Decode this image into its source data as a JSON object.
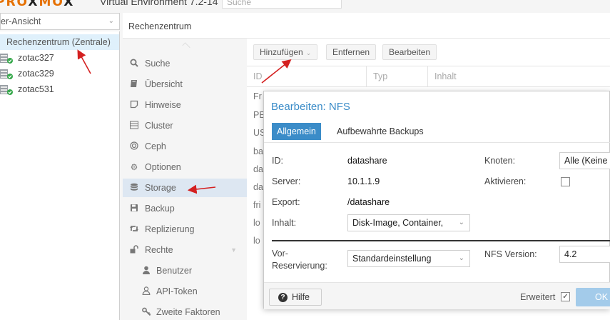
{
  "header": {
    "logo_part1": "PRO",
    "logo_x1": "X",
    "logo_part2": "MO",
    "logo_x2": "X",
    "version": "Virtual Environment 7.2-14",
    "search_placeholder": "Suche"
  },
  "tree": {
    "view_selector": "er-Ansicht",
    "root": "Rechenzentrum (Zentrale)",
    "nodes": [
      "zotac327",
      "zotac329",
      "zotac531"
    ]
  },
  "panel": {
    "title": "Rechenzentrum"
  },
  "nav": {
    "items": [
      {
        "label": "Suche",
        "icon": "search-icon"
      },
      {
        "label": "Übersicht",
        "icon": "book-icon"
      },
      {
        "label": "Hinweise",
        "icon": "note-icon"
      },
      {
        "label": "Cluster",
        "icon": "server-icon"
      },
      {
        "label": "Ceph",
        "icon": "ceph-icon"
      },
      {
        "label": "Optionen",
        "icon": "gear-icon"
      },
      {
        "label": "Storage",
        "icon": "database-icon"
      },
      {
        "label": "Backup",
        "icon": "floppy-icon"
      },
      {
        "label": "Replizierung",
        "icon": "retweet-icon"
      },
      {
        "label": "Rechte",
        "icon": "unlock-icon"
      },
      {
        "label": "Benutzer",
        "icon": "user-icon"
      },
      {
        "label": "API-Token",
        "icon": "user-outline-icon"
      },
      {
        "label": "Zweite Faktoren",
        "icon": "key-icon"
      }
    ]
  },
  "toolbar": {
    "add_label": "Hinzufügen",
    "remove_label": "Entfernen",
    "edit_label": "Bearbeiten"
  },
  "grid": {
    "columns": [
      "ID",
      "Typ",
      "Inhalt"
    ],
    "rows": [
      "Fr",
      "PE",
      "US",
      "ba",
      "da",
      "da",
      "fri",
      "lo",
      "lo"
    ]
  },
  "dialog": {
    "title": "Bearbeiten: NFS",
    "tabs": [
      "Allgemein",
      "Aufbewahrte Backups"
    ],
    "id_label": "ID:",
    "id_value": "datashare",
    "server_label": "Server:",
    "server_value": "10.1.1.9",
    "export_label": "Export:",
    "export_value": "/datashare",
    "content_label": "Inhalt:",
    "content_value": "Disk-Image, Container,",
    "nodes_label": "Knoten:",
    "nodes_value": "Alle (Keine",
    "enable_label": "Aktivieren:",
    "enabled": false,
    "prealloc_label_1": "Vor-",
    "prealloc_label_2": "Reservierung:",
    "prealloc_value": "Standardeinstellung",
    "nfs_version_label": "NFS Version:",
    "nfs_version_value": "4.2",
    "help_label": "Hilfe",
    "advanced_label": "Erweitert",
    "advanced_checked": true,
    "ok_label": "OK"
  },
  "colors": {
    "accent": "#3b8cc8",
    "selection": "#dff0fb",
    "logo": "#e57000",
    "arrow": "#d42020"
  }
}
